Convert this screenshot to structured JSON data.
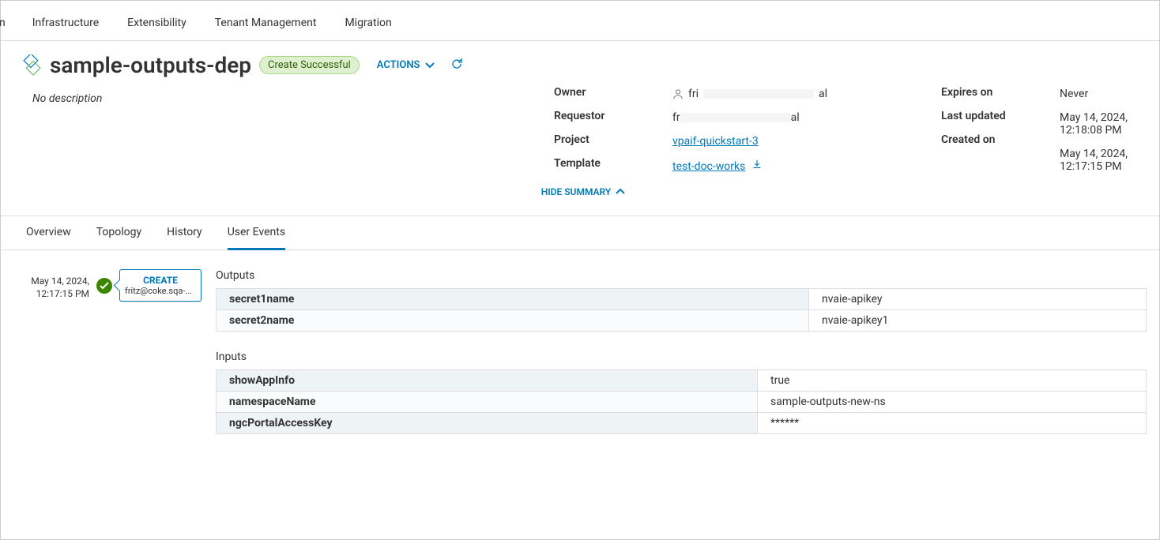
{
  "nav": {
    "partial_item": "n",
    "items": [
      "Infrastructure",
      "Extensibility",
      "Tenant Management",
      "Migration"
    ]
  },
  "header": {
    "title": "sample-outputs-dep",
    "status": "Create Successful",
    "actions_label": "ACTIONS"
  },
  "description": "No description",
  "summary": {
    "owner_label": "Owner",
    "owner_prefix": "fri",
    "owner_suffix": "al",
    "requestor_label": "Requestor",
    "requestor_prefix": "fr",
    "requestor_suffix": "al",
    "project_label": "Project",
    "project_value": "vpaif-quickstart-3",
    "template_label": "Template",
    "template_value": "test-doc-works",
    "expires_label": "Expires on",
    "expires_value": "Never",
    "updated_label": "Last updated",
    "updated_value": "May 14, 2024, 12:18:08 PM",
    "created_label": "Created on",
    "created_value": "May 14, 2024, 12:17:15 PM",
    "hide_summary": "HIDE SUMMARY"
  },
  "tabs": {
    "overview": "Overview",
    "topology": "Topology",
    "history": "History",
    "user_events": "User Events"
  },
  "event": {
    "timestamp_line1": "May 14, 2024,",
    "timestamp_line2": "12:17:15 PM",
    "action": "CREATE",
    "user": "fritz@coke.sqa-..."
  },
  "outputs": {
    "section_label": "Outputs",
    "rows": [
      {
        "key": "secret1name",
        "value": "nvaie-apikey"
      },
      {
        "key": "secret2name",
        "value": "nvaie-apikey1"
      }
    ]
  },
  "inputs": {
    "section_label": "Inputs",
    "rows": [
      {
        "key": "showAppInfo",
        "value": "true"
      },
      {
        "key": "namespaceName",
        "value": "sample-outputs-new-ns"
      },
      {
        "key": "ngcPortalAccessKey",
        "value": "******"
      }
    ]
  }
}
